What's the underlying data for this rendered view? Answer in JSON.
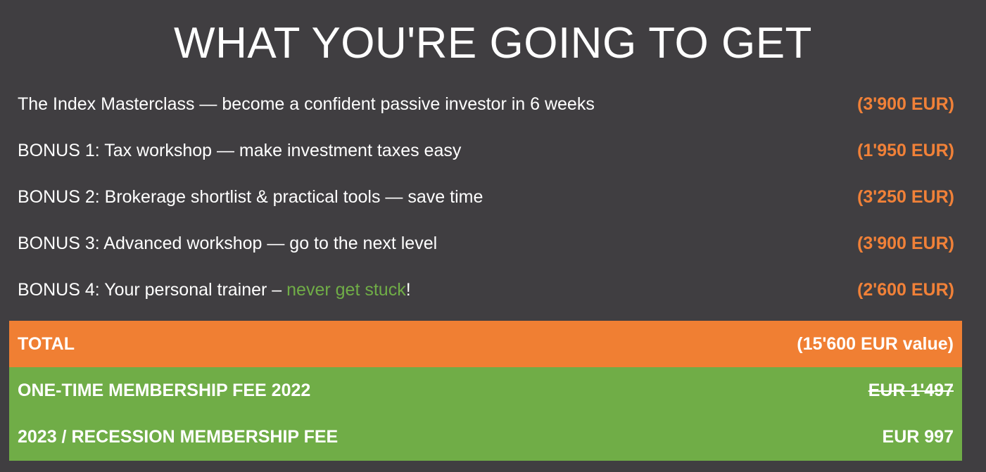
{
  "title": "WHAT YOU'RE GOING TO GET",
  "items": [
    {
      "label": "The Index Masterclass — become a confident passive investor in 6 weeks",
      "price": "(3'900 EUR)"
    },
    {
      "label": "BONUS 1: Tax workshop — make investment taxes easy",
      "price": "(1'950 EUR)"
    },
    {
      "label": "BONUS 2: Brokerage shortlist & practical tools — save time",
      "price": "(3'250 EUR)"
    },
    {
      "label": "BONUS 3: Advanced workshop — go to the next level",
      "price": "(3'900 EUR)"
    },
    {
      "label_prefix": "BONUS 4: Your personal trainer – ",
      "label_highlight": "never get stuck",
      "label_suffix": "!",
      "price": "(2'600 EUR)"
    }
  ],
  "total": {
    "label": "TOTAL",
    "value": "(15'600 EUR value)"
  },
  "fees": [
    {
      "label": "ONE-TIME MEMBERSHIP FEE 2022",
      "value": "EUR 1'497",
      "struck": true
    },
    {
      "label": "2023 / RECESSION MEMBERSHIP FEE",
      "value": "EUR 997",
      "struck": false
    }
  ],
  "colors": {
    "background": "#403e41",
    "accent_orange": "#f07f33",
    "accent_green": "#70ad47",
    "text": "#ffffff"
  }
}
